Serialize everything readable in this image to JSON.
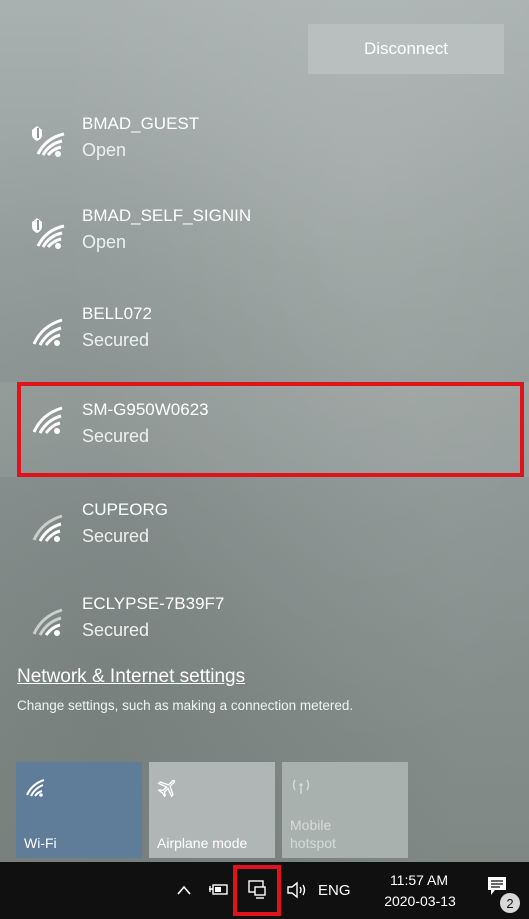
{
  "flyout": {
    "disconnect_label": "Disconnect",
    "networks": [
      {
        "name": "BMAD_GUEST",
        "status": "Open",
        "shield": true
      },
      {
        "name": "BMAD_SELF_SIGNIN",
        "status": "Open",
        "shield": true
      },
      {
        "name": "BELL072",
        "status": "Secured",
        "shield": false
      },
      {
        "name": "SM-G950W0623",
        "status": "Secured",
        "shield": false,
        "highlighted": true
      },
      {
        "name": "CUPEORG",
        "status": "Secured",
        "shield": false
      },
      {
        "name": "ECLYPSE-7B39F7",
        "status": "Secured",
        "shield": false
      }
    ],
    "settings_link": "Network & Internet settings",
    "settings_sub": "Change settings, such as making a connection metered."
  },
  "quick_actions": [
    {
      "label": "Wi-Fi",
      "icon": "wifi-icon",
      "active": true
    },
    {
      "label": "Airplane mode",
      "icon": "airplane-icon",
      "active": false
    },
    {
      "label": "Mobile\nhotspot",
      "icon": "hotspot-icon",
      "active": false,
      "disabled": true
    }
  ],
  "taskbar": {
    "language": "ENG",
    "time": "11:57 AM",
    "date": "2020-03-13",
    "notifications_count": "2"
  },
  "colors": {
    "highlight": "#e0121b",
    "wifi_tile": "#5f7c98"
  }
}
